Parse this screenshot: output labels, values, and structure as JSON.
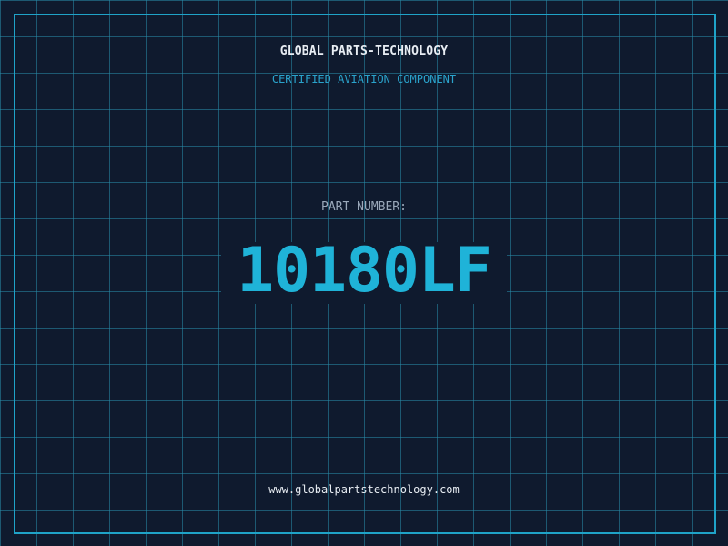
{
  "header": {
    "company": "GLOBAL PARTS-TECHNOLOGY",
    "subtitle": "CERTIFIED AVIATION COMPONENT"
  },
  "part": {
    "label": "PART NUMBER:",
    "number": "10180LF"
  },
  "footer": {
    "url": "www.globalpartstechnology.com"
  },
  "colors": {
    "background": "#0f1a2e",
    "grid": "#288caa",
    "accent": "#1fb3d8",
    "text": "#e8edf3",
    "label": "#9aa8ba"
  }
}
